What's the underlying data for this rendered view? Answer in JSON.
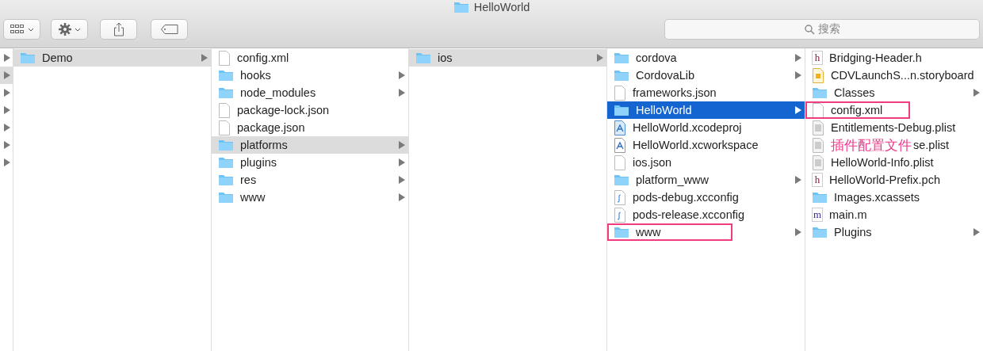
{
  "window": {
    "title": "HelloWorld"
  },
  "toolbar": {
    "buttons": [
      {
        "kind": "view"
      },
      {
        "kind": "action"
      },
      {
        "kind": "share"
      },
      {
        "kind": "tag"
      }
    ],
    "search": {
      "placeholder": "搜索"
    }
  },
  "columns": [
    {
      "kind": "stub",
      "active": false,
      "items": [
        {
          "expandable": true,
          "selected": false
        },
        {
          "expandable": true,
          "selected": true
        },
        {
          "expandable": true,
          "selected": false
        },
        {
          "expandable": true,
          "selected": false
        },
        {
          "expandable": true,
          "selected": false
        },
        {
          "expandable": true,
          "selected": false
        },
        {
          "expandable": true,
          "selected": false
        }
      ]
    },
    {
      "kind": "list",
      "active": false,
      "items": [
        {
          "name": "Demo",
          "kind": "folder",
          "expandable": true,
          "selected": true
        }
      ]
    },
    {
      "kind": "list",
      "active": false,
      "items": [
        {
          "name": "config.xml",
          "kind": "file",
          "expandable": false,
          "selected": false
        },
        {
          "name": "hooks",
          "kind": "folder",
          "expandable": true,
          "selected": false
        },
        {
          "name": "node_modules",
          "kind": "folder",
          "expandable": true,
          "selected": false
        },
        {
          "name": "package-lock.json",
          "kind": "file",
          "expandable": false,
          "selected": false
        },
        {
          "name": "package.json",
          "kind": "file",
          "expandable": false,
          "selected": false
        },
        {
          "name": "platforms",
          "kind": "folder",
          "expandable": true,
          "selected": true
        },
        {
          "name": "plugins",
          "kind": "folder",
          "expandable": true,
          "selected": false
        },
        {
          "name": "res",
          "kind": "folder",
          "expandable": true,
          "selected": false
        },
        {
          "name": "www",
          "kind": "folder",
          "expandable": true,
          "selected": false
        }
      ]
    },
    {
      "kind": "list",
      "active": false,
      "items": [
        {
          "name": "ios",
          "kind": "folder",
          "expandable": true,
          "selected": true
        }
      ]
    },
    {
      "kind": "list",
      "active": true,
      "items": [
        {
          "name": "cordova",
          "kind": "folder",
          "expandable": true,
          "selected": false
        },
        {
          "name": "CordovaLib",
          "kind": "folder",
          "expandable": true,
          "selected": false
        },
        {
          "name": "frameworks.json",
          "kind": "file",
          "expandable": false,
          "selected": false
        },
        {
          "name": "HelloWorld",
          "kind": "folder",
          "expandable": true,
          "selected": true
        },
        {
          "name": "HelloWorld.xcodeproj",
          "kind": "xcodeproj",
          "expandable": false,
          "selected": false
        },
        {
          "name": "HelloWorld.xcworkspace",
          "kind": "xcworkspace",
          "expandable": false,
          "selected": false
        },
        {
          "name": "ios.json",
          "kind": "file",
          "expandable": false,
          "selected": false
        },
        {
          "name": "platform_www",
          "kind": "folder",
          "expandable": true,
          "selected": false
        },
        {
          "name": "pods-debug.xcconfig",
          "kind": "xcconfig",
          "expandable": false,
          "selected": false
        },
        {
          "name": "pods-release.xcconfig",
          "kind": "xcconfig",
          "expandable": false,
          "selected": false
        },
        {
          "name": "www",
          "kind": "folder",
          "expandable": true,
          "selected": false,
          "highlighted": true
        }
      ]
    },
    {
      "kind": "list",
      "active": false,
      "items": [
        {
          "name": "Bridging-Header.h",
          "kind": "source",
          "badge": "h",
          "expandable": false,
          "selected": false
        },
        {
          "name": "CDVLaunchS...n.storyboard",
          "kind": "storyboard",
          "expandable": false,
          "selected": false
        },
        {
          "name": "Classes",
          "kind": "folder",
          "expandable": true,
          "selected": false
        },
        {
          "name": "config.xml",
          "kind": "file",
          "expandable": false,
          "selected": false,
          "highlighted": true
        },
        {
          "name": "Entitlements-Debug.plist",
          "kind": "plist",
          "expandable": false,
          "selected": false
        },
        {
          "name": "se.plist",
          "note": "插件配置文件",
          "kind": "plist",
          "expandable": false,
          "selected": false
        },
        {
          "name": "HelloWorld-Info.plist",
          "kind": "plist",
          "expandable": false,
          "selected": false
        },
        {
          "name": "HelloWorld-Prefix.pch",
          "kind": "source",
          "badge": "h",
          "expandable": false,
          "selected": false
        },
        {
          "name": "Images.xcassets",
          "kind": "folder",
          "expandable": false,
          "selected": false
        },
        {
          "name": "main.m",
          "kind": "source",
          "badge": "m",
          "expandable": false,
          "selected": false
        },
        {
          "name": "Plugins",
          "kind": "folder",
          "expandable": true,
          "selected": false
        }
      ]
    }
  ]
}
